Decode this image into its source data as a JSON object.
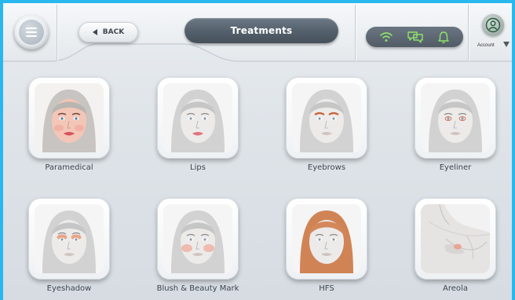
{
  "header": {
    "back_label": "BACK",
    "title": "Treatments",
    "account_label": "Account"
  },
  "icons": {
    "menu": "hamburger-menu-icon",
    "back": "back-arrow-icon",
    "wifi": "wifi-icon",
    "chat": "chat-icon",
    "bell": "bell-icon",
    "account": "user-icon",
    "caret": "chevron-down-icon"
  },
  "colors": {
    "frame_border": "#29b8ee",
    "status_icon": "#8fe26b",
    "title_bg": "#535f6a"
  },
  "treatments": [
    {
      "label": "Paramedical"
    },
    {
      "label": "Lips"
    },
    {
      "label": "Eyebrows"
    },
    {
      "label": "Eyeliner"
    },
    {
      "label": "Eyeshadow"
    },
    {
      "label": "Blush & Beauty Mark"
    },
    {
      "label": "HFS"
    },
    {
      "label": "Areola"
    }
  ]
}
